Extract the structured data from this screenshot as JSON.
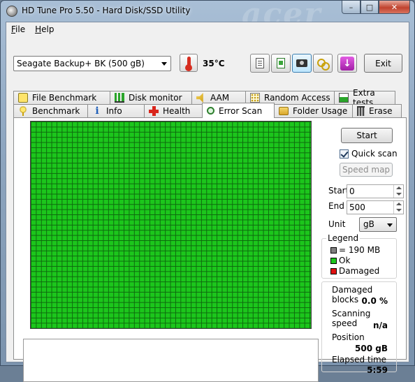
{
  "window": {
    "title": "HD Tune Pro 5.50 - Hard Disk/SSD Utility",
    "watermark": "acer",
    "controls": {
      "minimize": "–",
      "maximize": "□",
      "close": "✕"
    }
  },
  "menu": [
    {
      "accel": "F",
      "rest": "ile"
    },
    {
      "accel": "H",
      "rest": "elp"
    }
  ],
  "toolbar": {
    "drive": "Seagate Backup+ BK (500 gB)",
    "temperature": "35°C",
    "exit_label": "Exit",
    "icons": [
      "copy-info-icon",
      "copy-screen-icon",
      "screenshot-camera-icon",
      "options-chain-icon",
      "save-down-icon"
    ]
  },
  "tabs_back": [
    {
      "label": "File Benchmark",
      "icon": "file-benchmark-icon",
      "width": 139
    },
    {
      "label": "Disk monitor",
      "icon": "disk-monitor-icon",
      "width": 118
    },
    {
      "label": "AAM",
      "icon": "speaker-icon",
      "width": 78
    },
    {
      "label": "Random Access",
      "icon": "random-access-icon",
      "width": 128
    },
    {
      "label": "Extra tests",
      "icon": "extra-tests-icon",
      "width": 88
    }
  ],
  "tabs_front": [
    {
      "label": "Benchmark",
      "icon": "benchmark-icon",
      "width": 107
    },
    {
      "label": "Info",
      "icon": "info-icon",
      "width": 82
    },
    {
      "label": "Health",
      "icon": "health-cross-icon",
      "width": 84
    },
    {
      "label": "Error Scan",
      "icon": "magnifier-icon",
      "width": 104,
      "selected": true
    },
    {
      "label": "Folder Usage",
      "icon": "folder-icon",
      "width": 113
    },
    {
      "label": "Erase",
      "icon": "trash-icon",
      "width": 71
    }
  ],
  "scan": {
    "start_label": "Start",
    "quick_scan_label": "Quick scan",
    "quick_scan_checked": true,
    "speed_map_label": "Speed map",
    "start_field_label": "Start",
    "start_value": "0",
    "end_field_label": "End",
    "end_value": "500",
    "unit_label": "Unit",
    "unit_value": "gB"
  },
  "legend": {
    "title": "Legend",
    "items": [
      {
        "label": "= 190 MB",
        "color": "#808080"
      },
      {
        "label": "Ok",
        "color": "#1cc61c"
      },
      {
        "label": "Damaged",
        "color": "#e01010"
      }
    ]
  },
  "stats": {
    "damaged_label": "Damaged blocks",
    "damaged_value": "0.0 %",
    "speed_label": "Scanning speed",
    "speed_value": "n/a",
    "position_label": "Position",
    "position_value": "500 gB",
    "elapsed_label": "Elapsed time",
    "elapsed_value": "5:59"
  },
  "colors": {
    "ok": "#1cc61c",
    "damaged": "#e01010",
    "unit": "#808080"
  }
}
